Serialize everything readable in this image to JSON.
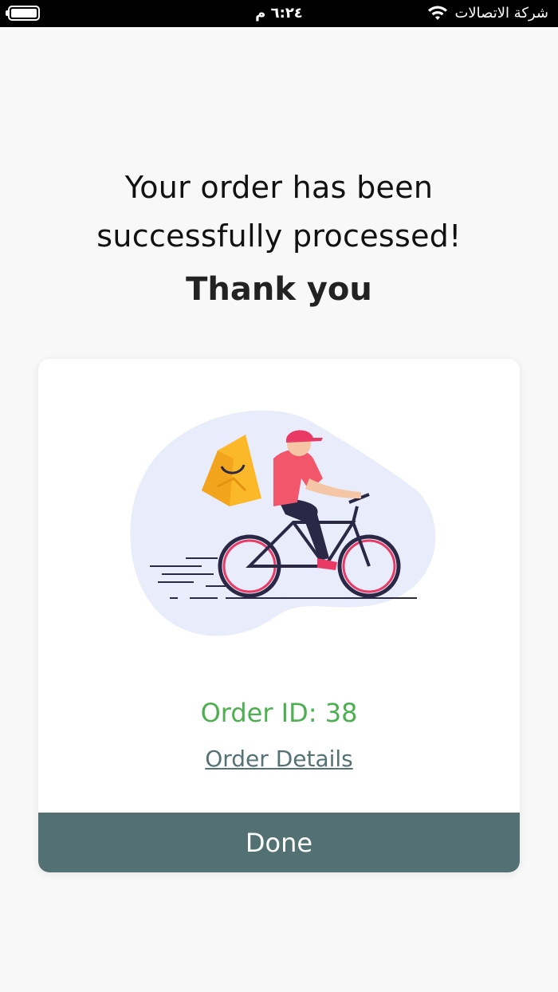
{
  "status_bar": {
    "time": "٦:٢٤ م",
    "carrier": "شركة الاتصالات"
  },
  "confirmation": {
    "line1": "Your order has been",
    "line2": "successfully processed!",
    "thank_you": "Thank you"
  },
  "card": {
    "order_id": "Order ID: 38",
    "order_details_link": "Order Details",
    "done_button": "Done"
  },
  "colors": {
    "accent_green": "#4caf50",
    "button_teal": "#537173",
    "link_color": "#547174"
  },
  "icons": [
    "battery-icon",
    "wifi-icon",
    "delivery-bike-illustration"
  ]
}
